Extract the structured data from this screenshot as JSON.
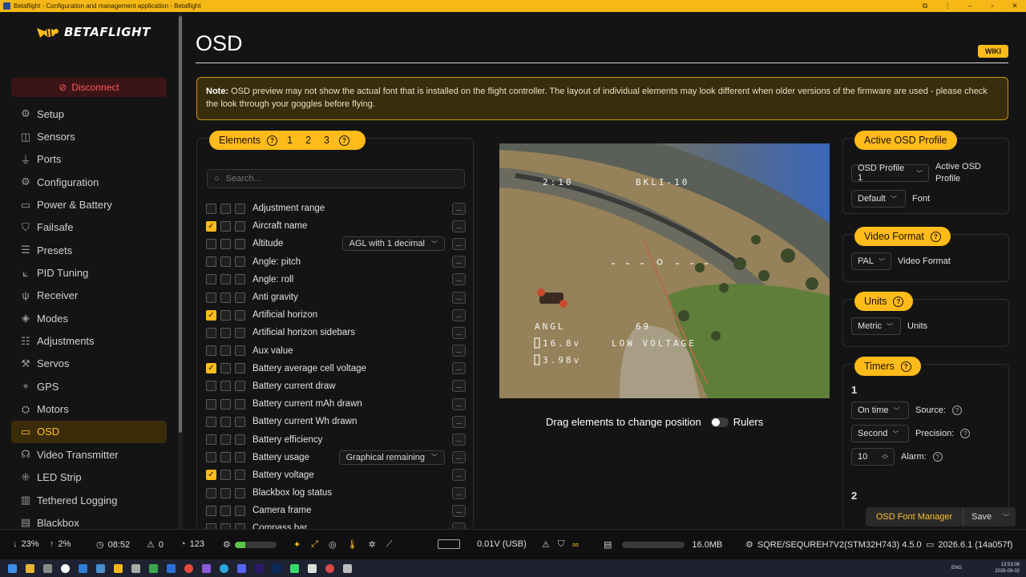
{
  "window": {
    "title": "Betaflight - Configuration and management application - Betaflight"
  },
  "sidebar": {
    "logo_text": "BETAFLIGHT",
    "disconnect_label": "Disconnect",
    "items": [
      {
        "label": "Setup",
        "icon": "gear-check-icon"
      },
      {
        "label": "Sensors",
        "icon": "chip-icon"
      },
      {
        "label": "Ports",
        "icon": "plug-icon"
      },
      {
        "label": "Configuration",
        "icon": "gear-icon"
      },
      {
        "label": "Power & Battery",
        "icon": "battery-icon"
      },
      {
        "label": "Failsafe",
        "icon": "shield-icon"
      },
      {
        "label": "Presets",
        "icon": "presets-icon"
      },
      {
        "label": "PID Tuning",
        "icon": "pid-icon"
      },
      {
        "label": "Receiver",
        "icon": "antenna-icon"
      },
      {
        "label": "Modes",
        "icon": "modes-icon"
      },
      {
        "label": "Adjustments",
        "icon": "sliders-icon"
      },
      {
        "label": "Servos",
        "icon": "servo-icon"
      },
      {
        "label": "GPS",
        "icon": "location-icon"
      },
      {
        "label": "Motors",
        "icon": "motor-icon"
      },
      {
        "label": "OSD",
        "icon": "monitor-icon",
        "active": true
      },
      {
        "label": "Video Transmitter",
        "icon": "broadcast-icon"
      },
      {
        "label": "LED Strip",
        "icon": "led-icon"
      },
      {
        "label": "Tethered Logging",
        "icon": "log-icon"
      },
      {
        "label": "Blackbox",
        "icon": "database-icon"
      }
    ]
  },
  "page": {
    "title": "OSD",
    "wiki_label": "WIKI",
    "note_bold": "Note:",
    "note_text": " OSD preview may not show the actual font that is installed on the flight controller. The layout of individual elements may look different when older versions of the firmware are used - please check the look through your goggles before flying."
  },
  "elements": {
    "header": "Elements",
    "tabs": [
      "1",
      "2",
      "3"
    ],
    "search_placeholder": "Search...",
    "rows": [
      {
        "label": "Adjustment range",
        "checked": false
      },
      {
        "label": "Aircraft name",
        "checked": true
      },
      {
        "label": "Altitude",
        "checked": false,
        "select": "AGL with 1 decimal"
      },
      {
        "label": "Angle: pitch",
        "checked": false
      },
      {
        "label": "Angle: roll",
        "checked": false
      },
      {
        "label": "Anti gravity",
        "checked": false
      },
      {
        "label": "Artificial horizon",
        "checked": true
      },
      {
        "label": "Artificial horizon sidebars",
        "checked": false
      },
      {
        "label": "Aux value",
        "checked": false
      },
      {
        "label": "Battery average cell voltage",
        "checked": true
      },
      {
        "label": "Battery current draw",
        "checked": false
      },
      {
        "label": "Battery current mAh drawn",
        "checked": false
      },
      {
        "label": "Battery current Wh drawn",
        "checked": false
      },
      {
        "label": "Battery efficiency",
        "checked": false
      },
      {
        "label": "Battery usage",
        "checked": false,
        "select": "Graphical remaining"
      },
      {
        "label": "Battery voltage",
        "checked": true
      },
      {
        "label": "Blackbox log status",
        "checked": false
      },
      {
        "label": "Camera frame",
        "checked": false
      },
      {
        "label": "Compass bar",
        "checked": false
      }
    ],
    "more_label": "..."
  },
  "preview": {
    "osd_time": "2:10",
    "osd_name": "BKLI-10",
    "osd_angl": "ANGL",
    "osd_angl_val": "69",
    "osd_voltage": "16.8v",
    "osd_warning": "LOW VOLTAGE",
    "osd_cell": "3.98v",
    "drag_hint": "Drag elements to change position",
    "rulers_label": "Rulers"
  },
  "profile": {
    "header": "Active OSD Profile",
    "profile_value": "OSD Profile 1",
    "profile_label": "Active OSD Profile",
    "font_value": "Default",
    "font_label": "Font"
  },
  "video": {
    "header": "Video Format",
    "value": "PAL",
    "label": "Video Format"
  },
  "units": {
    "header": "Units",
    "value": "Metric",
    "label": "Units"
  },
  "timers": {
    "header": "Timers",
    "timer1_num": "1",
    "source_value": "On time",
    "source_label": "Source:",
    "precision_value": "Second",
    "precision_label": "Precision:",
    "alarm_value": "10",
    "alarm_label": "Alarm:",
    "timer2_num": "2"
  },
  "footer": {
    "font_manager": "OSD Font Manager",
    "save": "Save"
  },
  "statusbar": {
    "down": "23%",
    "up": "2%",
    "time": "08:52",
    "warnings": "0",
    "loop": "123",
    "cpu_load": 0.25,
    "voltage": "0.01V (USB)",
    "mem": "16.0MB",
    "board": "SQRE/SEQUREH7V2(STM32H743) 4.5.0",
    "version": "2026.6.1 (14a057f)"
  },
  "taskbar": {
    "lang": "ENG",
    "clock": "13:53:08",
    "date": "2026-09-02"
  },
  "colors": {
    "accent": "#ffbb1a",
    "disconnect": "#ff5a5a",
    "background": "#141414"
  }
}
